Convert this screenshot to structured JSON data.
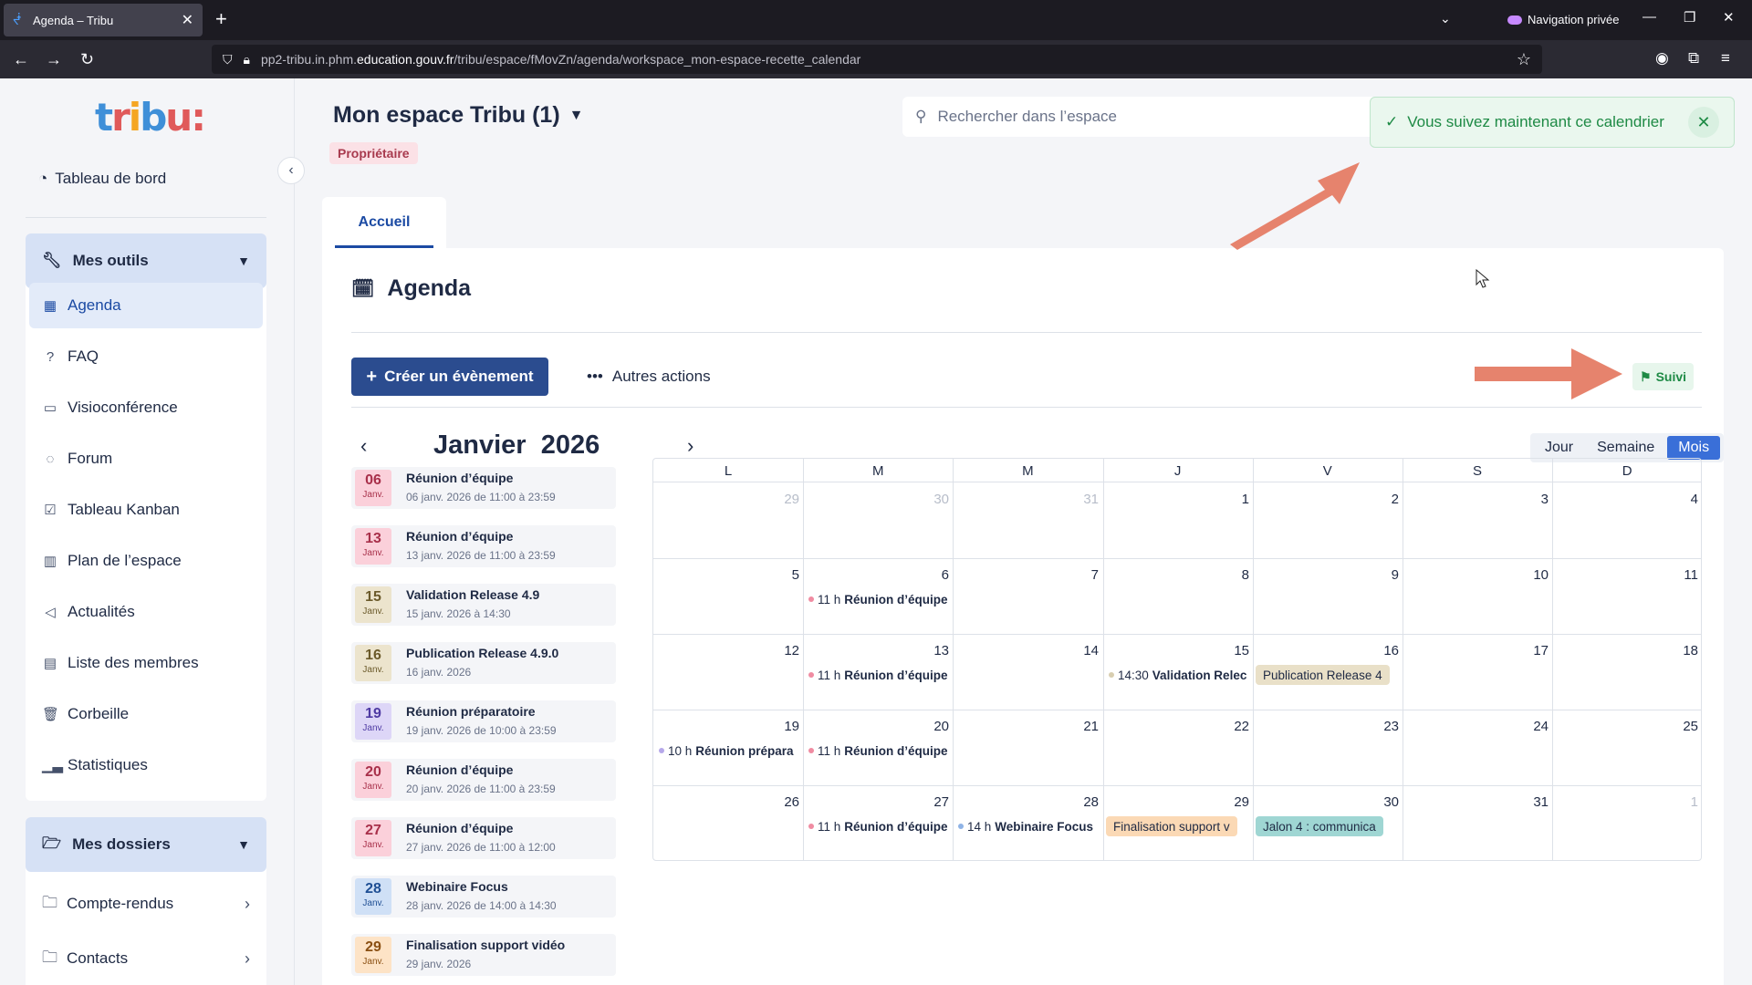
{
  "browser": {
    "tab_title": "Agenda – Tribu",
    "new_tab": "+",
    "private_label": "Navigation privée",
    "url_prefix": "pp2-tribu.in.phm.",
    "url_domain": "education.gouv.fr",
    "url_path": "/tribu/espace/fMovZn/agenda/workspace_mon-espace-recette_calendar"
  },
  "sidebar": {
    "logo": "tribu:",
    "dashboard": "Tableau de bord",
    "tools_group": "Mes outils",
    "items": [
      {
        "label": "Agenda",
        "icon": "calendar-icon"
      },
      {
        "label": "FAQ",
        "icon": "help-circle-icon"
      },
      {
        "label": "Visioconférence",
        "icon": "video-icon"
      },
      {
        "label": "Forum",
        "icon": "chat-icon"
      },
      {
        "label": "Tableau Kanban",
        "icon": "check-square-icon"
      },
      {
        "label": "Plan de l’espace",
        "icon": "map-icon"
      },
      {
        "label": "Actualités",
        "icon": "megaphone-icon"
      },
      {
        "label": "Liste des membres",
        "icon": "contacts-icon"
      },
      {
        "label": "Corbeille",
        "icon": "trash-icon"
      },
      {
        "label": "Statistiques",
        "icon": "bar-chart-icon"
      }
    ],
    "folders_group": "Mes dossiers",
    "folders": [
      {
        "label": "Compte-rendus"
      },
      {
        "label": "Contacts"
      }
    ]
  },
  "header": {
    "space_title": "Mon espace Tribu (1)",
    "role_badge": "Propriétaire",
    "search_placeholder": "Rechercher dans l’espace",
    "toast": "Vous suivez maintenant ce calendrier"
  },
  "tabs": [
    {
      "label": "Accueil"
    }
  ],
  "agenda": {
    "title": "Agenda",
    "create_button": "Créer un évènement",
    "more_actions": "Autres actions",
    "follow_button": "Suivi",
    "month": "Janvier",
    "year": "2026",
    "views": [
      "Jour",
      "Semaine",
      "Mois"
    ],
    "active_view": "Mois",
    "weekdays": [
      "L",
      "M",
      "M",
      "J",
      "V",
      "S",
      "D"
    ],
    "weeks": [
      [
        {
          "n": "29",
          "muted": true
        },
        {
          "n": "30",
          "muted": true
        },
        {
          "n": "31",
          "muted": true
        },
        {
          "n": "1"
        },
        {
          "n": "2"
        },
        {
          "n": "3"
        },
        {
          "n": "4"
        }
      ],
      [
        {
          "n": "5"
        },
        {
          "n": "6"
        },
        {
          "n": "7"
        },
        {
          "n": "8"
        },
        {
          "n": "9"
        },
        {
          "n": "10"
        },
        {
          "n": "11"
        }
      ],
      [
        {
          "n": "12"
        },
        {
          "n": "13"
        },
        {
          "n": "14"
        },
        {
          "n": "15"
        },
        {
          "n": "16"
        },
        {
          "n": "17"
        },
        {
          "n": "18"
        }
      ],
      [
        {
          "n": "19"
        },
        {
          "n": "20"
        },
        {
          "n": "21"
        },
        {
          "n": "22"
        },
        {
          "n": "23"
        },
        {
          "n": "24"
        },
        {
          "n": "25"
        }
      ],
      [
        {
          "n": "26"
        },
        {
          "n": "27"
        },
        {
          "n": "28"
        },
        {
          "n": "29"
        },
        {
          "n": "30"
        },
        {
          "n": "31"
        },
        {
          "n": "1",
          "muted": true
        }
      ]
    ],
    "calendar_events": [
      {
        "week": 1,
        "col": 1,
        "time": "11 h",
        "title": "Réunion d’équipe",
        "color": "#f08ca2"
      },
      {
        "week": 2,
        "col": 1,
        "time": "11 h",
        "title": "Réunion d’équipe",
        "color": "#f08ca2"
      },
      {
        "week": 2,
        "col": 3,
        "time": "14:30",
        "title": "Validation Relec",
        "color": "#d8ceb0"
      },
      {
        "week": 2,
        "col": 4,
        "pill": true,
        "title": "Publication Release 4",
        "color": "#e9e0c8"
      },
      {
        "week": 3,
        "col": 0,
        "time": "10 h",
        "title": "Réunion prépara",
        "color": "#b6a8ea"
      },
      {
        "week": 3,
        "col": 1,
        "time": "11 h",
        "title": "Réunion d’équipe",
        "color": "#f08ca2"
      },
      {
        "week": 4,
        "col": 1,
        "time": "11 h",
        "title": "Réunion d’équipe",
        "color": "#f08ca2"
      },
      {
        "week": 4,
        "col": 2,
        "time": "14 h",
        "title": "Webinaire Focus",
        "color": "#8fb3e6"
      },
      {
        "week": 4,
        "col": 3,
        "pill": true,
        "title": "Finalisation support v",
        "color": "#fbd9b5"
      },
      {
        "week": 4,
        "col": 4,
        "pill": true,
        "title": "Jalon 4 : communica",
        "color": "#9fd6d3"
      }
    ],
    "list_events": [
      {
        "day": "06",
        "mon": "Janv.",
        "title": "Réunion d’équipe",
        "sub": "06 janv. 2026 de 11:00 à 23:59",
        "bg": "#fbd0da",
        "fg": "#a8304a"
      },
      {
        "day": "13",
        "mon": "Janv.",
        "title": "Réunion d’équipe",
        "sub": "13 janv. 2026 de 11:00 à 23:59",
        "bg": "#fbd0da",
        "fg": "#a8304a"
      },
      {
        "day": "15",
        "mon": "Janv.",
        "title": "Validation Release 4.9",
        "sub": "15 janv. 2026 à 14:30",
        "bg": "#ece4cd",
        "fg": "#6b5a2a"
      },
      {
        "day": "16",
        "mon": "Janv.",
        "title": "Publication Release 4.9.0",
        "sub": "16 janv. 2026",
        "bg": "#ece4cd",
        "fg": "#6b5a2a"
      },
      {
        "day": "19",
        "mon": "Janv.",
        "title": "Réunion préparatoire",
        "sub": "19 janv. 2026 de 10:00 à 23:59",
        "bg": "#ddd6f7",
        "fg": "#4e3aa3"
      },
      {
        "day": "20",
        "mon": "Janv.",
        "title": "Réunion d’équipe",
        "sub": "20 janv. 2026 de 11:00 à 23:59",
        "bg": "#fbd0da",
        "fg": "#a8304a"
      },
      {
        "day": "27",
        "mon": "Janv.",
        "title": "Réunion d’équipe",
        "sub": "27 janv. 2026 de 11:00 à 12:00",
        "bg": "#fbd0da",
        "fg": "#a8304a"
      },
      {
        "day": "28",
        "mon": "Janv.",
        "title": "Webinaire Focus",
        "sub": "28 janv. 2026 de 14:00 à 14:30",
        "bg": "#cfe0f6",
        "fg": "#1f4f94"
      },
      {
        "day": "29",
        "mon": "Janv.",
        "title": "Finalisation support vidéo",
        "sub": "29 janv. 2026",
        "bg": "#fde3c6",
        "fg": "#8a4f12"
      }
    ]
  },
  "colors": {
    "primary": "#2b4c8f",
    "accent": "#3a6fd8",
    "success": "#1e8a45",
    "annotation_arrow": "#e6836d"
  }
}
